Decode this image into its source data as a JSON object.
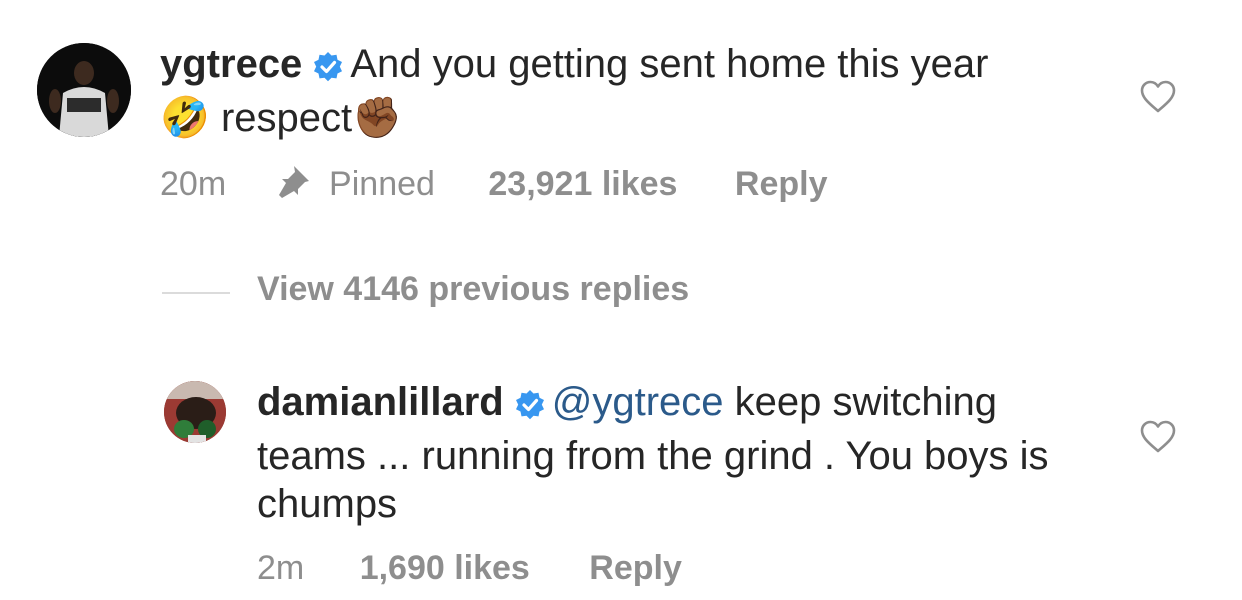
{
  "comment": {
    "username": "ygtrece",
    "text_line1": "And you getting sent home this year",
    "emoji_laugh": "🤣",
    "text_line2": "respect",
    "emoji_fist": "✊🏾",
    "time": "20m",
    "pinned_label": "Pinned",
    "likes": "23,921 likes",
    "reply_label": "Reply"
  },
  "view_replies": "View 4146 previous replies",
  "reply": {
    "username": "damianlillard",
    "mention": "@ygtrece",
    "text": "keep switching teams ... running from the grind . You boys is chumps",
    "time": "2m",
    "likes": "1,690 likes",
    "reply_label": "Reply"
  },
  "colors": {
    "text": "#262626",
    "muted": "#8e8e8e",
    "mention": "#2b5a8a",
    "verified": "#3897f0"
  },
  "icons": [
    "verified-badge-icon",
    "pin-icon",
    "heart-icon"
  ]
}
